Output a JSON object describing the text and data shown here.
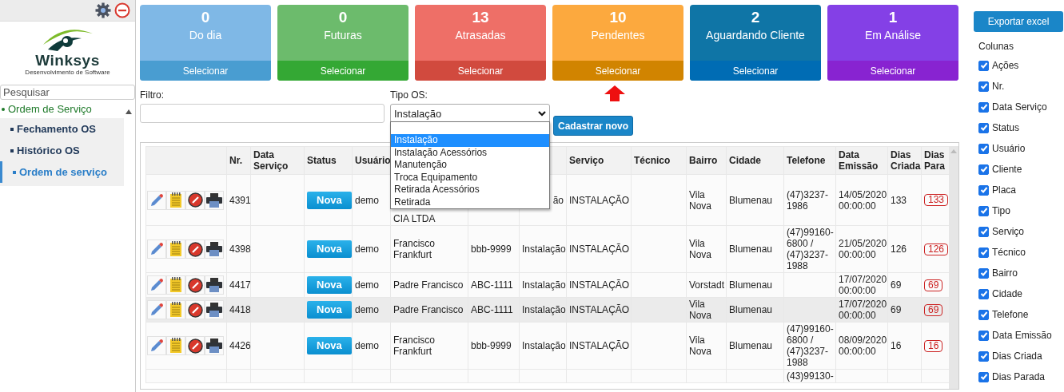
{
  "sidebar": {
    "search": {
      "placeholder": "Pesquisar"
    },
    "logo": {
      "name": "Winksys",
      "tagline": "Desenvolvimento de Software"
    },
    "menu": [
      {
        "label": "Ordem de Serviço",
        "selected": false,
        "children": [
          {
            "label": "Fechamento OS",
            "selected": false
          },
          {
            "label": "Histórico OS",
            "selected": false
          },
          {
            "label": "Ordem de serviço",
            "selected": true
          }
        ]
      }
    ]
  },
  "cards": [
    {
      "count": "0",
      "label": "Do dia",
      "action": "Selecionar",
      "color": "#7fb8e6",
      "pointed": false
    },
    {
      "count": "0",
      "label": "Futuras",
      "action": "Selecionar",
      "color": "#6cbb6c",
      "pointed": false
    },
    {
      "count": "13",
      "label": "Atrasadas",
      "action": "Selecionar",
      "color": "#ee6f67",
      "pointed": false
    },
    {
      "count": "10",
      "label": "Pendentes",
      "action": "Selecionar",
      "color": "#fca93e",
      "pointed": true
    },
    {
      "count": "2",
      "label": "Aguardando Cliente",
      "action": "Selecionar",
      "color": "#0f75a6",
      "pointed": false
    },
    {
      "count": "1",
      "label": "Em Análise",
      "action": "Selecionar",
      "color": "#8440e6",
      "pointed": false
    }
  ],
  "filter": {
    "label": "Filtro:"
  },
  "tipo_os": {
    "label": "Tipo OS:",
    "value": "Instalação",
    "expanded": true,
    "options": [
      {
        "label": "Instalação",
        "selected": true
      },
      {
        "label": "Instalação Acessórios",
        "selected": false
      },
      {
        "label": "Manutenção",
        "selected": false
      },
      {
        "label": "Troca Equipamento",
        "selected": false
      },
      {
        "label": "Retirada Acessórios",
        "selected": false
      },
      {
        "label": "Retirada",
        "selected": false
      }
    ]
  },
  "new_button": "Cadastrar novo",
  "table": {
    "columns": [
      null,
      "Nr.",
      "Data Serviço",
      "Status",
      "Usuário",
      null,
      null,
      null,
      "Serviço",
      "Técnico",
      "Bairro",
      "Cidade",
      "Telefone",
      "Data Emissão",
      "Dias Criada",
      "Dias Para"
    ],
    "rows": [
      {
        "actions": true,
        "highlighted": false,
        "cut": false,
        "cells": [
          null,
          "4391",
          null,
          "Nova",
          "demo",
          {
            "text": "CIA LTDA",
            "covered": true
          },
          null,
          {
            "text": "ão",
            "covered": true
          },
          "INSTALAÇÃO",
          null,
          "Vila Nova",
          "Blumenau",
          "(47)3237-1986",
          "14/05/2020 00:00:00",
          "133",
          "133"
        ]
      },
      {
        "actions": true,
        "highlighted": false,
        "cut": false,
        "cells": [
          null,
          "4398",
          null,
          "Nova",
          "demo",
          "Francisco Frankfurt",
          "bbb-9999",
          "Instalação",
          "INSTALAÇÃO",
          null,
          "Vila Nova",
          "Blumenau",
          "(47)99160-6800 / (47)3237-1988",
          "21/05/2020 00:00:00",
          "126",
          "126"
        ]
      },
      {
        "actions": true,
        "highlighted": false,
        "cut": false,
        "cells": [
          null,
          "4417",
          null,
          "Nova",
          "demo",
          "Padre Francisco",
          "ABC-1111",
          "Instalação",
          "INSTALAÇÃO",
          null,
          "Vorstadt",
          "Blumenau",
          null,
          "17/07/2020 00:00:00",
          "69",
          "69"
        ]
      },
      {
        "actions": true,
        "highlighted": true,
        "cut": false,
        "cells": [
          null,
          "4418",
          null,
          "Nova",
          "demo",
          "Padre Francisco",
          "ABC-1111",
          "Instalação",
          "INSTALAÇÃO",
          null,
          "Vila Nova",
          "Blumenau",
          null,
          "17/07/2020 00:00:00",
          "69",
          "69"
        ]
      },
      {
        "actions": true,
        "highlighted": false,
        "cut": false,
        "cells": [
          null,
          "4426",
          null,
          "Nova",
          "demo",
          "Francisco Frankfurt",
          "bbb-9999",
          "Instalação",
          "INSTALAÇÃO",
          null,
          "Vila Nova",
          "Blumenau",
          "(47)99160-6800 / (47)3237-1988",
          "08/09/2020 00:00:00",
          "16",
          "16"
        ]
      },
      {
        "highlighted": false,
        "cut": true,
        "cells": [
          null,
          null,
          null,
          null,
          null,
          null,
          null,
          null,
          null,
          null,
          null,
          null,
          "(43)99130-",
          null,
          null,
          null
        ]
      }
    ]
  },
  "export_button": "Exportar excel",
  "columns_panel": {
    "title": "Colunas",
    "items": [
      {
        "label": "Ações",
        "checked": true
      },
      {
        "label": "Nr.",
        "checked": true
      },
      {
        "label": "Data Serviço",
        "checked": true
      },
      {
        "label": "Status",
        "checked": true
      },
      {
        "label": "Usuário",
        "checked": true
      },
      {
        "label": "Cliente",
        "checked": true
      },
      {
        "label": "Placa",
        "checked": true
      },
      {
        "label": "Tipo",
        "checked": true
      },
      {
        "label": "Serviço",
        "checked": true
      },
      {
        "label": "Técnico",
        "checked": true
      },
      {
        "label": "Bairro",
        "checked": true
      },
      {
        "label": "Cidade",
        "checked": true
      },
      {
        "label": "Telefone",
        "checked": true
      },
      {
        "label": "Data Emissão",
        "checked": true
      },
      {
        "label": "Dias Criada",
        "checked": true
      },
      {
        "label": "Dias Parada",
        "checked": true
      }
    ]
  }
}
